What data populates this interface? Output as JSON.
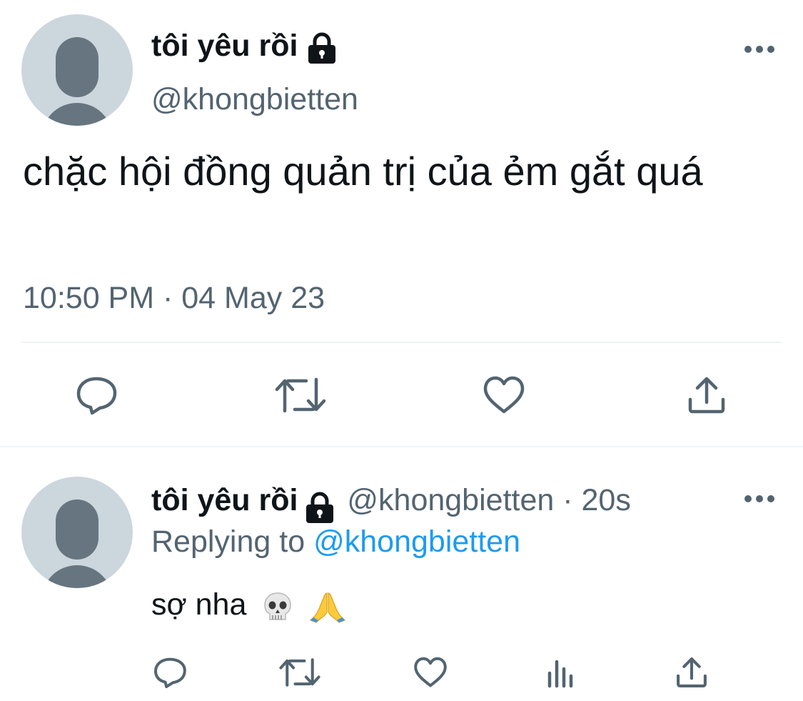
{
  "main_tweet": {
    "display_name": "tôi yêu rồi",
    "handle": "@khongbietten",
    "text": "chặc hội đồng quản trị của ẻm gắt quá",
    "timestamp": "10:50 PM · 04 May 23",
    "protected_icon": "lock-icon",
    "more_icon": "more-horizontal-icon",
    "actions": [
      "reply-icon",
      "retweet-icon",
      "like-icon",
      "share-icon"
    ]
  },
  "reply_tweet": {
    "display_name": "tôi yêu rồi",
    "handle": "@khongbietten",
    "time_sep": " · ",
    "time": "20s",
    "replying_to_label": "Replying to",
    "replying_to_handle": "@khongbietten",
    "text": "sợ nha",
    "emojis": [
      "skull-emoji",
      "folded-hands-emoji"
    ],
    "protected_icon": "lock-icon",
    "more_icon": "more-horizontal-icon",
    "actions": [
      "reply-icon",
      "retweet-icon",
      "like-icon",
      "analytics-icon",
      "share-icon"
    ]
  },
  "colors": {
    "text_primary": "#0f1419",
    "text_secondary": "#536471",
    "link": "#1d9bf0",
    "avatar_bg": "#ccd6dd",
    "avatar_fg": "#66757f",
    "divider": "#eff3f4"
  }
}
